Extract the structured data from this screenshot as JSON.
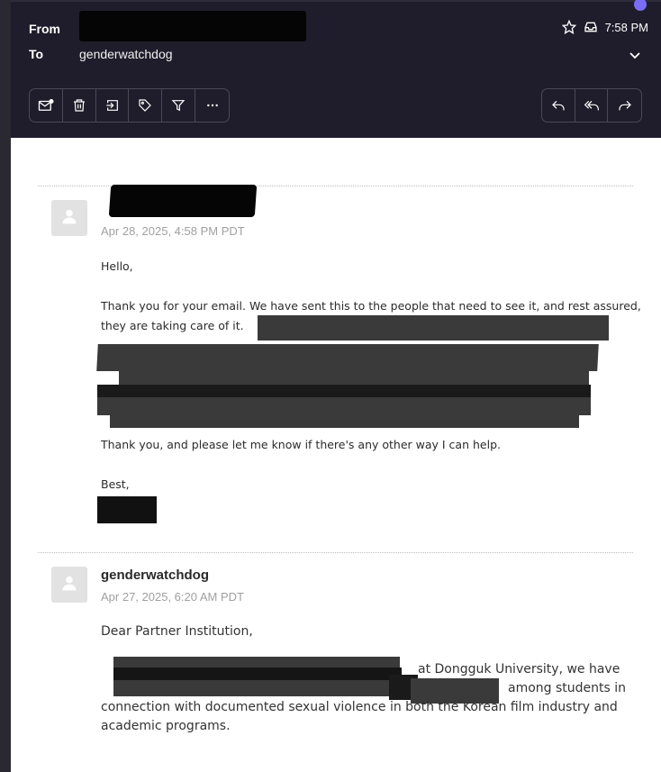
{
  "header": {
    "from_label": "From",
    "to_label": "To",
    "to_value": "genderwatchdog",
    "time": "7:58 PM"
  },
  "toolbar": {
    "left_icons": [
      "mark-unread-icon",
      "trash-icon",
      "move-icon",
      "tag-icon",
      "filter-icon",
      "more-icon"
    ],
    "right_icons": [
      "reply-icon",
      "reply-all-icon",
      "forward-icon"
    ]
  },
  "messages": [
    {
      "sender": "",
      "date": "Apr 28, 2025, 4:58 PM PDT",
      "greeting": "Hello,",
      "para1_line1": "Thank you for your email. We have sent this to the people that need to see it, and rest assured,",
      "para1_line2": "they are taking care of it.",
      "para2": "Thank you, and please let me know if there's any other way I can help.",
      "signoff": "Best,"
    },
    {
      "sender": "genderwatchdog",
      "date": "Apr 27, 2025, 6:20 AM PDT",
      "greeting": "Dear Partner Institution,",
      "line1_tail": "at Dongguk University, we have",
      "line2_tail": "among students in",
      "line3": "connection with documented sexual violence in both the Korean film industry and",
      "line4": "academic programs."
    }
  ],
  "colors": {
    "header_bg": "#1f1d2b",
    "body_bg": "#ffffff",
    "accent": "#7b6cf6"
  }
}
